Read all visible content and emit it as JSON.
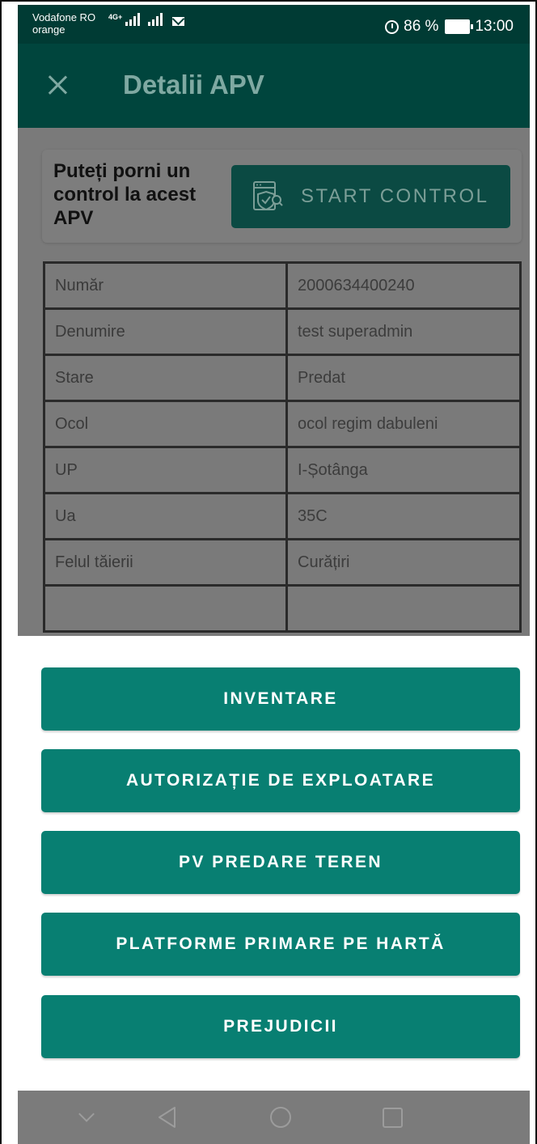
{
  "status_bar": {
    "carrier_1": "Vodafone RO",
    "carrier_2": "orange",
    "network": "4G+",
    "battery": "86 %",
    "time": "13:00"
  },
  "app_bar": {
    "title": "Detalii APV",
    "close_icon": "close-icon"
  },
  "control_card": {
    "text": "Puteți porni un control la acest APV",
    "button_label": "START CONTROL",
    "button_icon": "shield-doc-icon"
  },
  "details_table": {
    "rows": [
      {
        "label": "Număr",
        "value": "2000634400240"
      },
      {
        "label": "Denumire",
        "value": "test superadmin"
      },
      {
        "label": "Stare",
        "value": "Predat"
      },
      {
        "label": "Ocol",
        "value": "ocol regim dabuleni"
      },
      {
        "label": "UP",
        "value": "I-Șotânga"
      },
      {
        "label": "Ua",
        "value": "35C"
      },
      {
        "label": "Felul tăierii",
        "value": "Curățiri"
      },
      {
        "label": "",
        "value": ""
      }
    ]
  },
  "sheet": {
    "buttons": [
      {
        "label": "INVENTARE"
      },
      {
        "label": "AUTORIZAȚIE DE EXPLOATARE"
      },
      {
        "label": "PV PREDARE TEREN"
      },
      {
        "label": "PLATFORME PRIMARE PE HARTĂ"
      },
      {
        "label": "PREJUDICII"
      }
    ]
  },
  "colors": {
    "status_bar": "#003b34",
    "app_bar_dimmed": "#00453d",
    "accent_button": "#087f72",
    "scrim_content": "#7a7a7a",
    "nav_bar": "#7b7b7b"
  },
  "nav_bar": {
    "icons": [
      "hide-keyboard-icon",
      "back-icon",
      "home-icon",
      "recents-icon"
    ]
  }
}
